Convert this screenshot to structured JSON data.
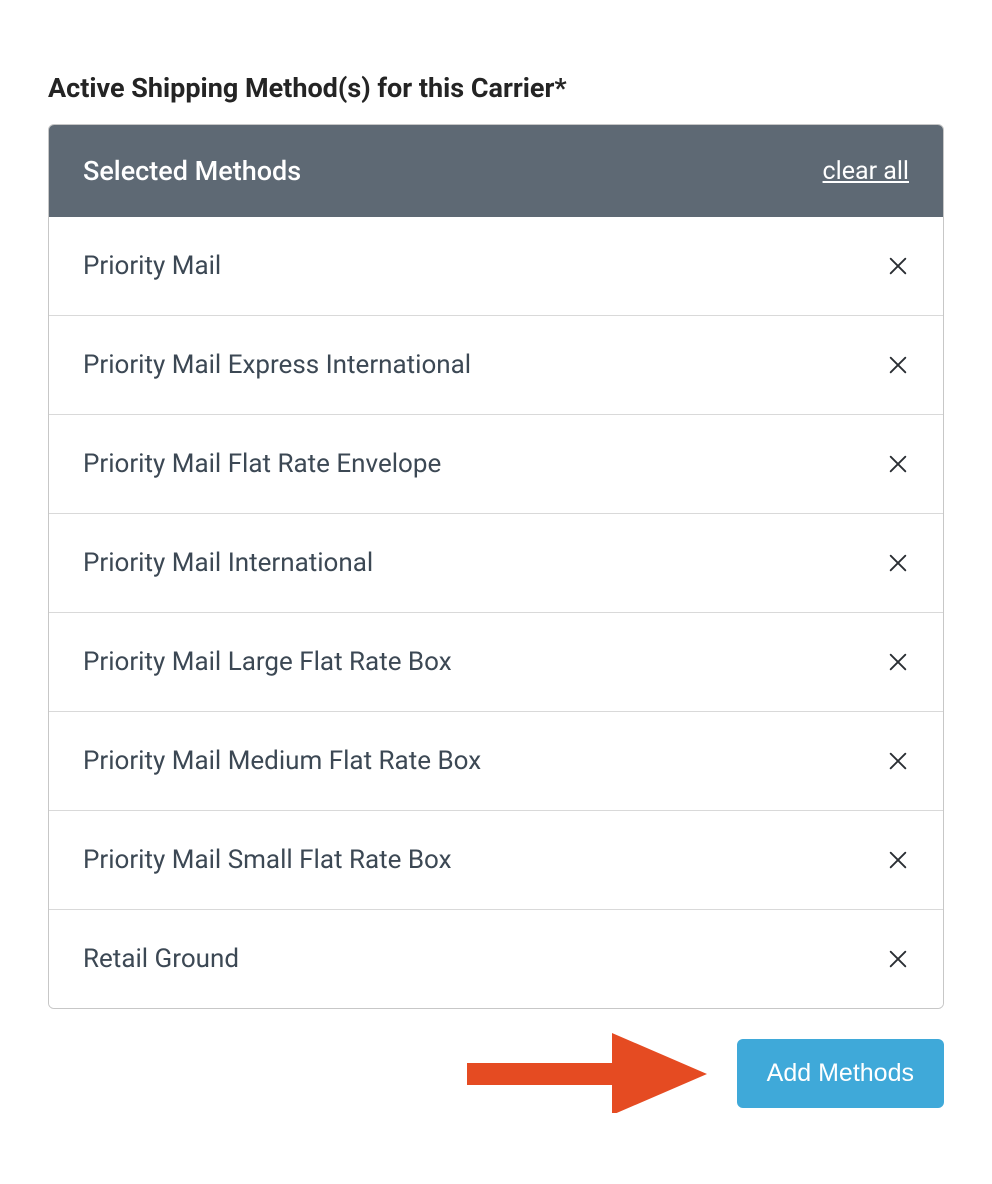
{
  "section_title": "Active Shipping Method(s) for this Carrier*",
  "panel": {
    "header_title": "Selected Methods",
    "clear_all_label": "clear all",
    "items": [
      {
        "label": "Priority Mail"
      },
      {
        "label": "Priority Mail Express International"
      },
      {
        "label": "Priority Mail Flat Rate Envelope"
      },
      {
        "label": "Priority Mail International"
      },
      {
        "label": "Priority Mail Large Flat Rate Box"
      },
      {
        "label": "Priority Mail Medium Flat Rate Box"
      },
      {
        "label": "Priority Mail Small Flat Rate Box"
      },
      {
        "label": "Retail Ground"
      }
    ]
  },
  "add_methods_label": "Add Methods",
  "colors": {
    "header_bg": "#5e6974",
    "arrow": "#e54b22",
    "button_bg": "#3fa9d9"
  }
}
